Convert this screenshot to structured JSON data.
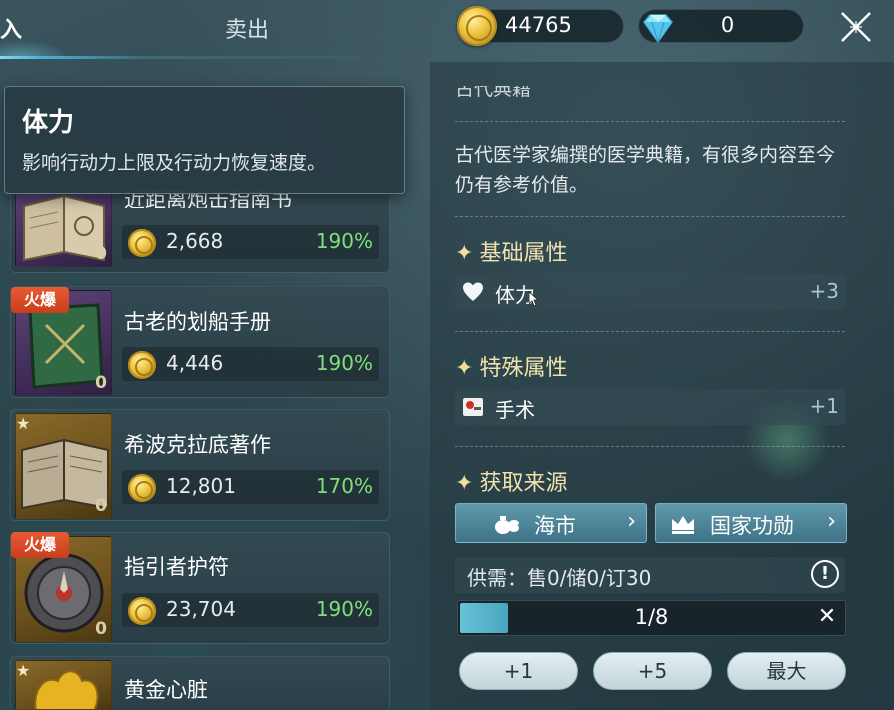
{
  "tabs": {
    "buy_label": "入",
    "sell_label": "卖出"
  },
  "currency": {
    "coins": "44765",
    "gems": "0"
  },
  "tooltip": {
    "title": "体力",
    "description": "影响行动力上限及行动力恢复速度。"
  },
  "items": [
    {
      "name": "近距离炮击指南书",
      "price": "2,668",
      "percent": "190%",
      "quantity": "0",
      "badge": "",
      "starred": false,
      "frame": "purple"
    },
    {
      "name": "古老的划船手册",
      "price": "4,446",
      "percent": "190%",
      "quantity": "0",
      "badge": "火爆",
      "starred": false,
      "frame": "purple"
    },
    {
      "name": "希波克拉底著作",
      "price": "12,801",
      "percent": "170%",
      "quantity": "0",
      "badge": "",
      "starred": true,
      "frame": "gold"
    },
    {
      "name": "指引者护符",
      "price": "23,704",
      "percent": "190%",
      "quantity": "0",
      "badge": "火爆",
      "starred": false,
      "frame": "gold"
    },
    {
      "name": "黄金心脏",
      "price": "",
      "percent": "",
      "quantity": "",
      "badge": "",
      "starred": true,
      "frame": "gold"
    }
  ],
  "detail": {
    "clipped_top": "古代典籍",
    "description": "古代医学家编撰的医学典籍，有很多内容至今仍有参考价值。",
    "basic_title": "基础属性",
    "basic_attr": {
      "label": "体力",
      "value": "+3",
      "icon": "heart-icon"
    },
    "special_title": "特殊属性",
    "special_attr": {
      "label": "手术",
      "value": "+1",
      "icon": "surgery-icon"
    },
    "source_title": "获取来源",
    "sources": [
      {
        "label": "海市",
        "icon": "money-bag-icon"
      },
      {
        "label": "国家功勋",
        "icon": "crown-icon"
      }
    ],
    "supply": "供需：售0/储0/订30",
    "purchase": {
      "current": 1,
      "max": 8,
      "text": "1/8"
    },
    "steps": [
      "+1",
      "+5",
      "最大"
    ]
  },
  "colors": {
    "accent": "#66c2d6",
    "price_green": "#7fe07a",
    "hot_badge": "#d8482a",
    "section_gold": "#f0e2ad"
  }
}
